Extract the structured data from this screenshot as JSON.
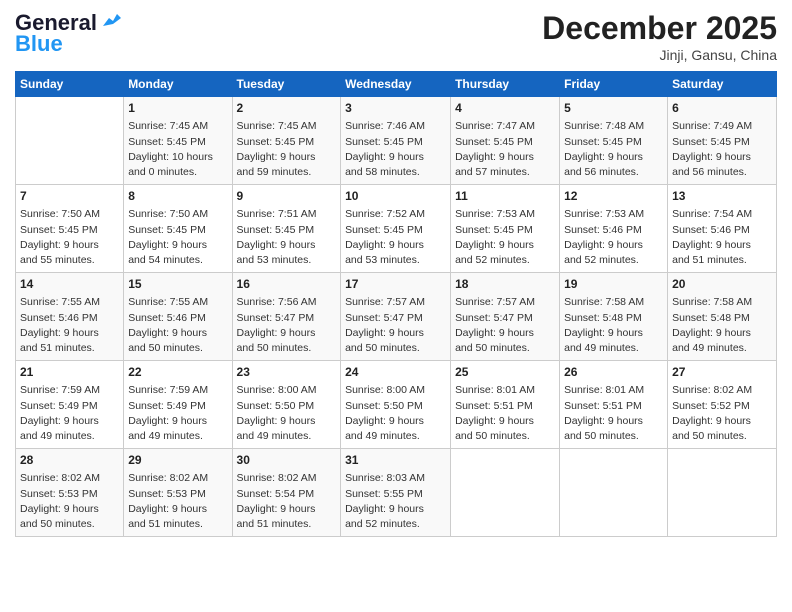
{
  "logo": {
    "line1": "General",
    "line2": "Blue"
  },
  "title": "December 2025",
  "subtitle": "Jinji, Gansu, China",
  "days_of_week": [
    "Sunday",
    "Monday",
    "Tuesday",
    "Wednesday",
    "Thursday",
    "Friday",
    "Saturday"
  ],
  "weeks": [
    [
      {
        "day": "",
        "info": ""
      },
      {
        "day": "1",
        "info": "Sunrise: 7:45 AM\nSunset: 5:45 PM\nDaylight: 10 hours\nand 0 minutes."
      },
      {
        "day": "2",
        "info": "Sunrise: 7:45 AM\nSunset: 5:45 PM\nDaylight: 9 hours\nand 59 minutes."
      },
      {
        "day": "3",
        "info": "Sunrise: 7:46 AM\nSunset: 5:45 PM\nDaylight: 9 hours\nand 58 minutes."
      },
      {
        "day": "4",
        "info": "Sunrise: 7:47 AM\nSunset: 5:45 PM\nDaylight: 9 hours\nand 57 minutes."
      },
      {
        "day": "5",
        "info": "Sunrise: 7:48 AM\nSunset: 5:45 PM\nDaylight: 9 hours\nand 56 minutes."
      },
      {
        "day": "6",
        "info": "Sunrise: 7:49 AM\nSunset: 5:45 PM\nDaylight: 9 hours\nand 56 minutes."
      }
    ],
    [
      {
        "day": "7",
        "info": "Sunrise: 7:50 AM\nSunset: 5:45 PM\nDaylight: 9 hours\nand 55 minutes."
      },
      {
        "day": "8",
        "info": "Sunrise: 7:50 AM\nSunset: 5:45 PM\nDaylight: 9 hours\nand 54 minutes."
      },
      {
        "day": "9",
        "info": "Sunrise: 7:51 AM\nSunset: 5:45 PM\nDaylight: 9 hours\nand 53 minutes."
      },
      {
        "day": "10",
        "info": "Sunrise: 7:52 AM\nSunset: 5:45 PM\nDaylight: 9 hours\nand 53 minutes."
      },
      {
        "day": "11",
        "info": "Sunrise: 7:53 AM\nSunset: 5:45 PM\nDaylight: 9 hours\nand 52 minutes."
      },
      {
        "day": "12",
        "info": "Sunrise: 7:53 AM\nSunset: 5:46 PM\nDaylight: 9 hours\nand 52 minutes."
      },
      {
        "day": "13",
        "info": "Sunrise: 7:54 AM\nSunset: 5:46 PM\nDaylight: 9 hours\nand 51 minutes."
      }
    ],
    [
      {
        "day": "14",
        "info": "Sunrise: 7:55 AM\nSunset: 5:46 PM\nDaylight: 9 hours\nand 51 minutes."
      },
      {
        "day": "15",
        "info": "Sunrise: 7:55 AM\nSunset: 5:46 PM\nDaylight: 9 hours\nand 50 minutes."
      },
      {
        "day": "16",
        "info": "Sunrise: 7:56 AM\nSunset: 5:47 PM\nDaylight: 9 hours\nand 50 minutes."
      },
      {
        "day": "17",
        "info": "Sunrise: 7:57 AM\nSunset: 5:47 PM\nDaylight: 9 hours\nand 50 minutes."
      },
      {
        "day": "18",
        "info": "Sunrise: 7:57 AM\nSunset: 5:47 PM\nDaylight: 9 hours\nand 50 minutes."
      },
      {
        "day": "19",
        "info": "Sunrise: 7:58 AM\nSunset: 5:48 PM\nDaylight: 9 hours\nand 49 minutes."
      },
      {
        "day": "20",
        "info": "Sunrise: 7:58 AM\nSunset: 5:48 PM\nDaylight: 9 hours\nand 49 minutes."
      }
    ],
    [
      {
        "day": "21",
        "info": "Sunrise: 7:59 AM\nSunset: 5:49 PM\nDaylight: 9 hours\nand 49 minutes."
      },
      {
        "day": "22",
        "info": "Sunrise: 7:59 AM\nSunset: 5:49 PM\nDaylight: 9 hours\nand 49 minutes."
      },
      {
        "day": "23",
        "info": "Sunrise: 8:00 AM\nSunset: 5:50 PM\nDaylight: 9 hours\nand 49 minutes."
      },
      {
        "day": "24",
        "info": "Sunrise: 8:00 AM\nSunset: 5:50 PM\nDaylight: 9 hours\nand 49 minutes."
      },
      {
        "day": "25",
        "info": "Sunrise: 8:01 AM\nSunset: 5:51 PM\nDaylight: 9 hours\nand 50 minutes."
      },
      {
        "day": "26",
        "info": "Sunrise: 8:01 AM\nSunset: 5:51 PM\nDaylight: 9 hours\nand 50 minutes."
      },
      {
        "day": "27",
        "info": "Sunrise: 8:02 AM\nSunset: 5:52 PM\nDaylight: 9 hours\nand 50 minutes."
      }
    ],
    [
      {
        "day": "28",
        "info": "Sunrise: 8:02 AM\nSunset: 5:53 PM\nDaylight: 9 hours\nand 50 minutes."
      },
      {
        "day": "29",
        "info": "Sunrise: 8:02 AM\nSunset: 5:53 PM\nDaylight: 9 hours\nand 51 minutes."
      },
      {
        "day": "30",
        "info": "Sunrise: 8:02 AM\nSunset: 5:54 PM\nDaylight: 9 hours\nand 51 minutes."
      },
      {
        "day": "31",
        "info": "Sunrise: 8:03 AM\nSunset: 5:55 PM\nDaylight: 9 hours\nand 52 minutes."
      },
      {
        "day": "",
        "info": ""
      },
      {
        "day": "",
        "info": ""
      },
      {
        "day": "",
        "info": ""
      }
    ]
  ]
}
